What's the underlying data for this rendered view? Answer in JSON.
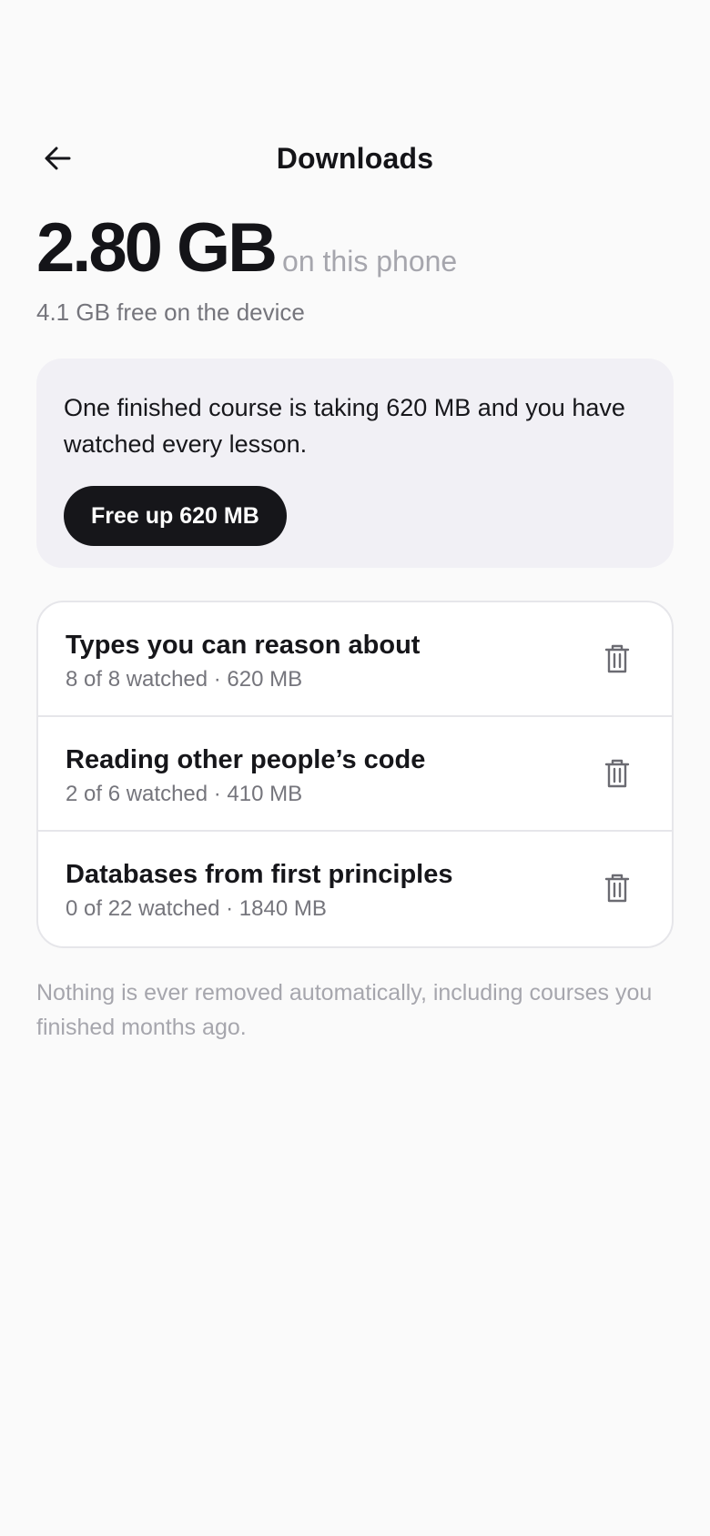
{
  "header": {
    "title": "Downloads",
    "back_icon": "arrow-left-icon"
  },
  "storage": {
    "amount": "2.80 GB",
    "suffix": "on this phone",
    "free": "4.1 GB free on the device"
  },
  "suggestion": {
    "text": "One finished course is taking 620 MB and you have watched every lesson.",
    "button_label": "Free up 620 MB"
  },
  "courses": [
    {
      "title": "Types you can reason about",
      "meta": "8 of 8 watched · 620 MB",
      "action_icon": "trash-icon"
    },
    {
      "title": "Reading other people’s code",
      "meta": "2 of 6 watched · 410 MB",
      "action_icon": "trash-icon"
    },
    {
      "title": "Databases from first principles",
      "meta": "0 of 22 watched · 1840 MB",
      "action_icon": "trash-icon"
    }
  ],
  "footnote": "Nothing is ever removed automatically, including courses you finished months ago.",
  "colors": {
    "background": "#fafafa",
    "card": "#f1f0f5",
    "primary_button": "#16161a",
    "muted_text": "#a6a6ad",
    "secondary_text": "#75757c",
    "border": "#e6e6ea"
  }
}
